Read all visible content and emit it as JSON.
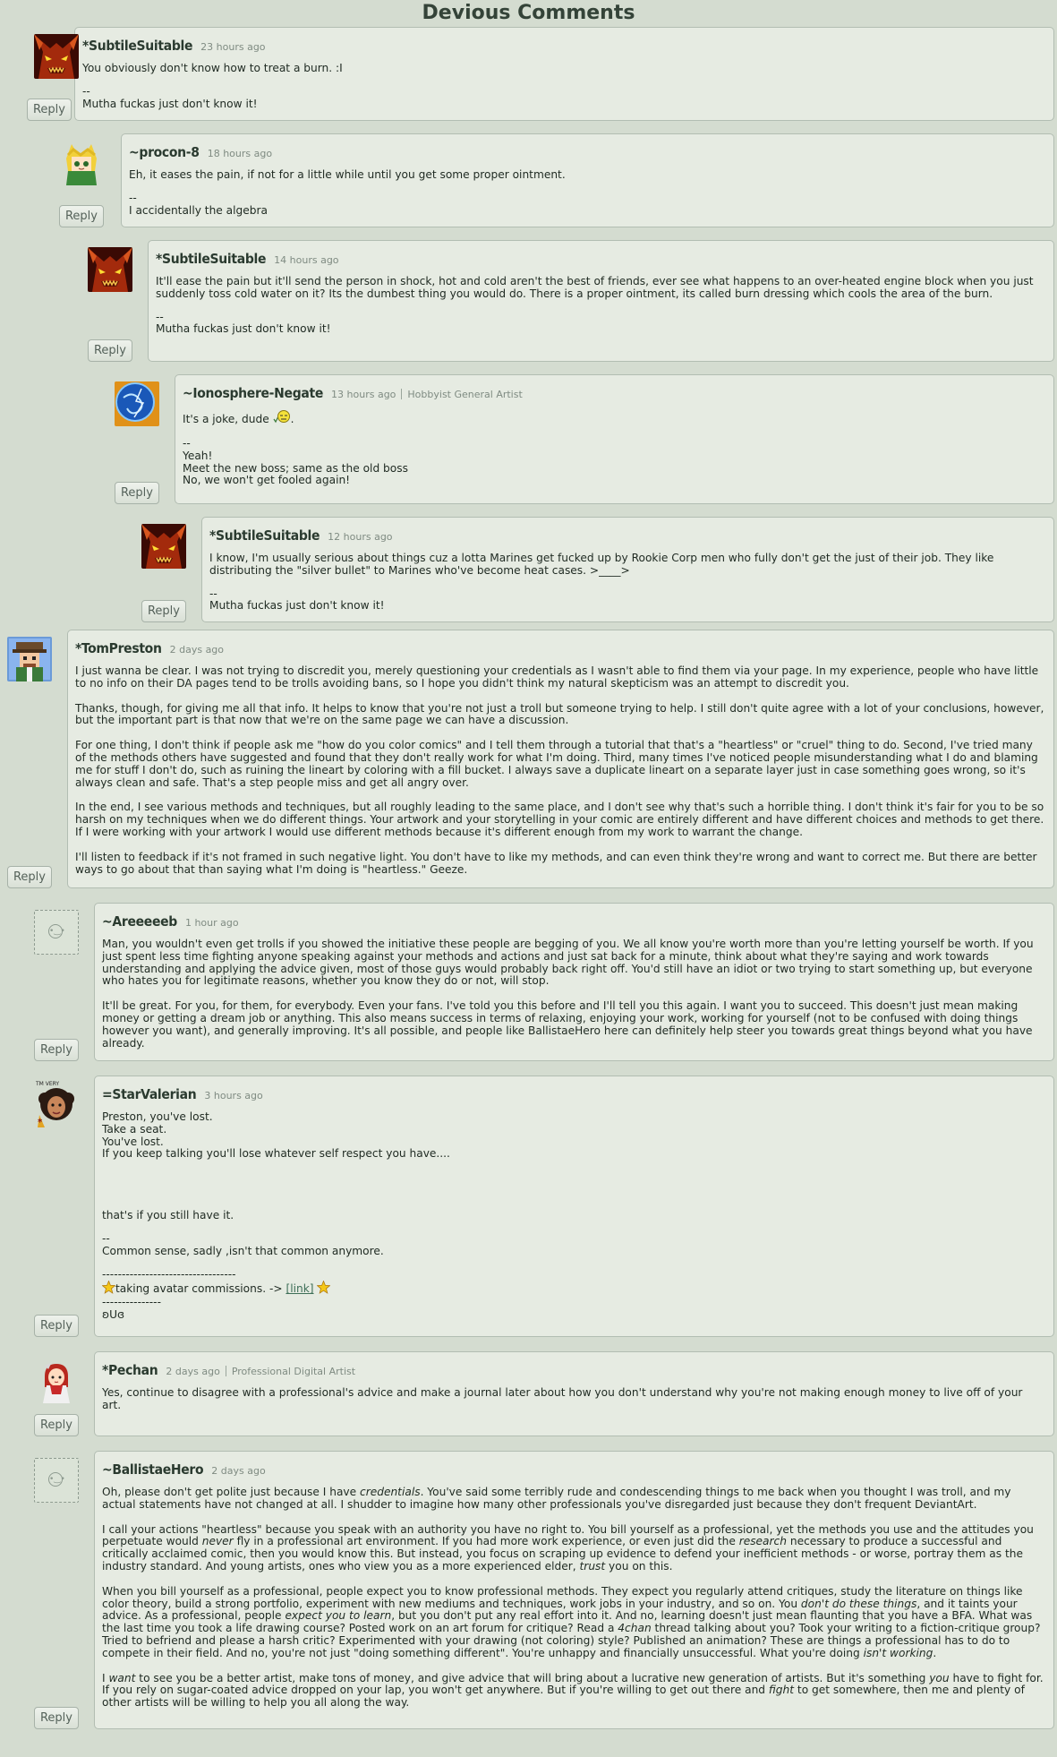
{
  "page_title": "Devious Comments",
  "reply_label": "Reply",
  "comments": [
    {
      "user": "*SubtileSuitable",
      "time": "23 hours ago",
      "avatar": "demon-avatar",
      "paragraphs": [
        "You obviously don't know how to treat a burn. :I"
      ],
      "sig_dash": "--",
      "sig": "Mutha fuckas just don't know it!"
    },
    {
      "user": "~procon-8",
      "time": "18 hours ago",
      "avatar": "blonde-catgirl-avatar",
      "paragraphs": [
        "Eh, it eases the pain, if not for a little while until you get some proper ointment."
      ],
      "sig_dash": "--",
      "sig": "I accidentally the algebra"
    },
    {
      "user": "*SubtileSuitable",
      "time": "14 hours ago",
      "avatar": "demon-avatar",
      "paragraphs": [
        "It'll ease the pain but it'll send the person in shock, hot and cold aren't the best of friends, ever see what happens to an over-heated engine block when you just suddenly toss cold water on it? Its the dumbest thing you would do. There is a proper ointment, its called burn dressing which cools the area of the burn."
      ],
      "sig_dash": "--",
      "sig": "Mutha fuckas just don't know it!"
    },
    {
      "user": "~Ionosphere-Negate",
      "time": "13 hours ago",
      "role": "Hobbyist General Artist",
      "avatar": "blue-orb-avatar",
      "joke_text": "It's a joke, dude",
      "joke_end": ".",
      "sig_dash": "--",
      "sig_lines": [
        "Yeah!",
        "Meet the new boss; same as the old boss",
        "No, we won't get fooled again!"
      ]
    },
    {
      "user": "*SubtileSuitable",
      "time": "12 hours ago",
      "avatar": "demon-avatar",
      "paragraphs": [
        "I know, I'm usually serious about things cuz a lotta Marines get fucked up by Rookie Corp men who fully don't get the just of their job. They like distributing the \"silver bullet\" to Marines who've become heat cases. >____>"
      ],
      "sig_dash": "--",
      "sig": "Mutha fuckas just don't know it!"
    },
    {
      "user": "*TomPreston",
      "time": "2 days ago",
      "avatar": "pixel-cowboy-avatar",
      "paragraphs": [
        "I just wanna be clear. I was not trying to discredit you, merely questioning your credentials as I wasn't able to find them via your page. In my experience, people who have little to no info on their DA pages tend to be trolls avoiding bans, so I hope you didn't think my natural skepticism was an attempt to discredit you.",
        "Thanks, though, for giving me all that info. It helps to know that you're not just a troll but someone trying to help. I still don't quite agree with a lot of your conclusions, however, but the important part is that now that we're on the same page we can have a discussion.",
        "For one thing, I don't think if people ask me \"how do you color comics\" and I tell them through a tutorial that that's a \"heartless\" or \"cruel\" thing to do. Second, I've tried many of the methods others have suggested and found that they don't really work for what I'm doing. Third, many times I've noticed people misunderstanding what I do and blaming me for stuff I don't do, such as ruining the lineart by coloring with a fill bucket. I always save a duplicate lineart on a separate layer just in case something goes wrong, so it's always clean and safe. That's a step people miss and get all angry over.",
        "In the end, I see various methods and techniques, but all roughly leading to the same place, and I don't see why that's such a horrible thing. I don't think it's fair for you to be so harsh on my techniques when we do different things. Your artwork and your storytelling in your comic are entirely different and have different choices and methods to get there. If I were working with your artwork I would use different methods because it's different enough from my work to warrant the change.",
        "I'll listen to feedback if it's not framed in such negative light. You don't have to like my methods, and can even think they're wrong and want to correct me. But there are better ways to go about that than saying what I'm doing is \"heartless.\" Geeze."
      ]
    },
    {
      "user": "~Areeeeeb",
      "time": "1 hour ago",
      "avatar": "default-avatar",
      "paragraphs": [
        "Man, you wouldn't even get trolls if you showed the initiative these people are begging of you. We all know you're worth more than you're letting yourself be worth. If you just spent less time fighting anyone speaking against your methods and actions and just sat back for a minute, think about what they're saying and work towards understanding and applying the advice given, most of those guys would probably back right off. You'd still have an idiot or two trying to start something up, but everyone who hates you for legitimate reasons, whether you know they do or not, will stop.",
        "It'll be great. For you, for them, for everybody. Even your fans. I've told you this before and I'll tell you this again. I want you to succeed. This doesn't just mean making money or getting a dream job or anything. This also means success in terms of relaxing, enjoying your work, working for yourself (not to be confused with doing things however you want), and generally improving. It's all possible, and people like BallistaeHero here can definitely help steer you towards great things beyond what you have already."
      ]
    },
    {
      "user": "=StarValerian",
      "time": "3 hours ago",
      "avatar": "curly-hair-avatar",
      "avatar_label": "TM VERY",
      "lines": [
        "Preston, you've lost.",
        "Take a seat.",
        "You've lost.",
        "If you keep talking you'll lose whatever self respect you have...."
      ],
      "after": "that's if you still have it.",
      "sig_dash": "--",
      "sig": "Common sense, sadly ,isn't that common anymore.",
      "divider": "----------------------------------",
      "commission_text": "taking avatar commissions. -> ",
      "commission_link": "[link]",
      "divider2": "---------------",
      "tail": "ʚUɞ"
    },
    {
      "user": "*Pechan",
      "time": "2 days ago",
      "role": "Professional Digital Artist",
      "avatar": "redhead-avatar",
      "paragraphs": [
        "Yes, continue to disagree with a professional's advice and make a journal later about how you don't understand why you're not making enough money to live off of your art."
      ]
    },
    {
      "user": "~BallistaeHero",
      "time": "2 days ago",
      "avatar": "default-avatar"
    }
  ],
  "ballistae": {
    "p1_a": "Oh, please don't get polite just because I have ",
    "p1_em": "credentials",
    "p1_b": ". You've said some terribly rude and condescending things to me back when you thought I was troll, and my actual statements have not changed at all. I shudder to imagine how many other professionals you've disregarded just because they don't frequent DeviantArt.",
    "p2_a": "I call your actions \"heartless\" because you speak with an authority you have no right to. You bill yourself as a professional, yet the methods you use and the attitudes you perpetuate would ",
    "p2_em1": "never",
    "p2_b": " fly in a professional art environment. If you had more work experience, or even just did the ",
    "p2_em2": "research",
    "p2_c": " necessary to produce a successful and critically acclaimed comic, then you would know this. But instead, you focus on scraping up evidence to defend your inefficient methods - or worse, portray them as the industry standard. And young artists, ones who view you as a more experienced elder, ",
    "p2_em3": "trust",
    "p2_d": " you on this.",
    "p3_a": "When you bill yourself as a professional, people expect you to know professional methods. They expect you regularly attend critiques, study the literature on things like color theory, build a strong portfolio, experiment with new mediums and techniques, work jobs in your industry, and so on. You ",
    "p3_em1": "don't do these things",
    "p3_b": ", and it taints your advice. As a professional, people ",
    "p3_em2": "expect you to learn",
    "p3_c": ", but you don't put any real effort into it. And no, learning doesn't just mean flaunting that you have a BFA. What was the last time you took a life drawing course? Posted work on an art forum for critique? Read a ",
    "p3_em3": "4chan",
    "p3_d": " thread talking about you? Took your writing to a fiction-critique group? Tried to befriend and please a harsh critic? Experimented with your drawing (not coloring) style? Published an animation? These are things a professional has to do to compete in their field. And no, you're not just \"doing something different\". You're unhappy and financially unsuccessful. What you're doing ",
    "p3_em4": "isn't working",
    "p3_e": ".",
    "p4_a": "I ",
    "p4_em1": "want",
    "p4_b": " to see you be a better artist, make tons of money, and give advice that will bring about a lucrative new generation of artists. But it's something ",
    "p4_em2": "you",
    "p4_c": " have to fight for. If you rely on sugar-coated advice dropped on your lap, you won't get anywhere. But if you're willing to get out there and ",
    "p4_em3": "fight",
    "p4_d": " to get somewhere, then me and plenty of other artists will be willing to help you all along the way."
  },
  "colors": {
    "background": "#d4dcd0",
    "box": "#e6ebe2",
    "border": "#b2bdb2",
    "username": "#2a3a2f",
    "timestamp": "#7f8b82",
    "link": "#3d6e57"
  }
}
